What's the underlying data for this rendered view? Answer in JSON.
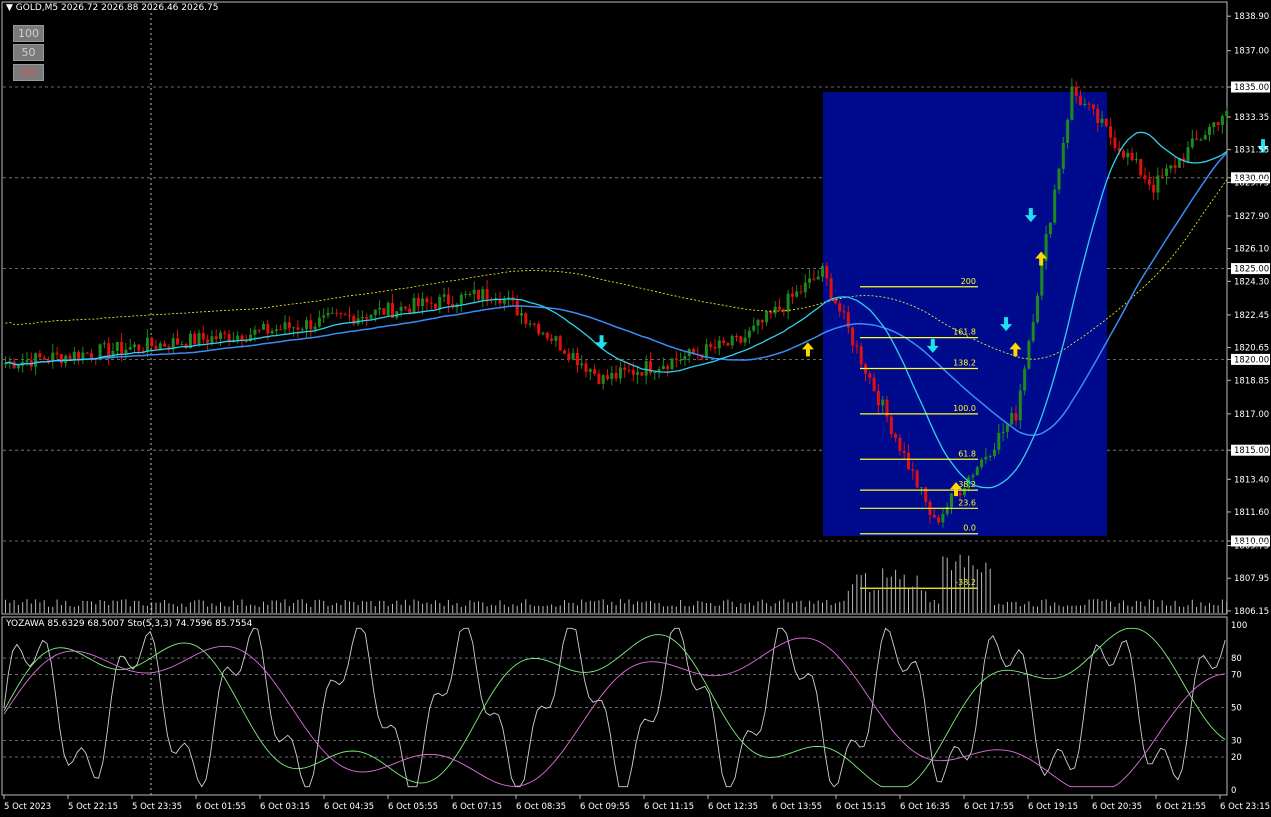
{
  "header": {
    "symbol": "GOLD,M5",
    "ohlc": "2026.72 2026.88 2026.46 2026.75",
    "menu_glyph": "▼"
  },
  "level_buttons": [
    "100",
    "50",
    "25"
  ],
  "indicator_header": "YOZAWA 85.6329 68.5007  Sto(5,3,3) 74.7596 85.7554",
  "price_axis": {
    "labels": [
      "1838.90",
      "1837.00",
      "1835.00",
      "1833.35",
      "1831.55",
      "1830.00",
      "1829.75",
      "1827.90",
      "1826.10",
      "1825.00",
      "1824.30",
      "1822.45",
      "1820.65",
      "1820.00",
      "1818.85",
      "1817.00",
      "1815.00",
      "1813.40",
      "1811.60",
      "1810.00",
      "1809.75",
      "1807.95",
      "1806.15"
    ],
    "highlighted": [
      "1835.00",
      "1830.00",
      "1825.00",
      "1820.00",
      "1815.00",
      "1810.00"
    ]
  },
  "osc_axis": {
    "labels": [
      "100",
      "80",
      "70",
      "50",
      "30",
      "20",
      "0"
    ]
  },
  "time_axis": {
    "labels": [
      "5 Oct 2023",
      "5 Oct 22:15",
      "5 Oct 23:35",
      "6 Oct 01:55",
      "6 Oct 03:15",
      "6 Oct 04:35",
      "6 Oct 05:55",
      "6 Oct 07:15",
      "6 Oct 08:35",
      "6 Oct 09:55",
      "6 Oct 11:15",
      "6 Oct 12:35",
      "6 Oct 13:55",
      "6 Oct 15:15",
      "6 Oct 16:35",
      "6 Oct 17:55",
      "6 Oct 19:15",
      "6 Oct 20:35",
      "6 Oct 21:55",
      "6 Oct 23:15"
    ]
  },
  "fib_labels": [
    "200",
    "161.8",
    "138.2",
    "100.0",
    "61.8",
    "38.2",
    "23.6",
    "0.0",
    "-38.2"
  ],
  "colors": {
    "bull": "#1e8a1e",
    "bear": "#e01010",
    "ma_fast": "#30d0f0",
    "ma_slow": "#3b8cf5",
    "ma_pink": "#e040a0",
    "fib": "#ffff20",
    "box": "#000a8c",
    "arrow_up": "#ffd700",
    "arrow_down": "#20e0f0"
  },
  "chart_data": {
    "type": "candlestick",
    "title": "",
    "symbol": "GOLD",
    "timeframe": "M5",
    "ylim": [
      1805.5,
      1839.8
    ],
    "x_range": [
      "5 Oct 2023 21:00",
      "6 Oct 23:55"
    ],
    "key_closes": [
      {
        "time": "5 Oct 21:00",
        "price": 1819.8
      },
      {
        "time": "6 Oct 01:55",
        "price": 1821.5
      },
      {
        "time": "6 Oct 06:30",
        "price": 1823.7
      },
      {
        "time": "6 Oct 08:35",
        "price": 1818.9
      },
      {
        "time": "6 Oct 11:15",
        "price": 1821.0
      },
      {
        "time": "6 Oct 12:50",
        "price": 1824.8
      },
      {
        "time": "6 Oct 15:00",
        "price": 1811.0
      },
      {
        "time": "6 Oct 16:35",
        "price": 1817.0
      },
      {
        "time": "6 Oct 17:40",
        "price": 1834.8
      },
      {
        "time": "6 Oct 19:15",
        "price": 1829.5
      },
      {
        "time": "6 Oct 20:35",
        "price": 1833.5
      },
      {
        "time": "6 Oct 23:55",
        "price": 1829.1
      }
    ],
    "fibonacci": [
      {
        "level": "200",
        "price": 1824.0
      },
      {
        "level": "161.8",
        "price": 1821.2
      },
      {
        "level": "138.2",
        "price": 1819.5
      },
      {
        "level": "100.0",
        "price": 1817.0
      },
      {
        "level": "61.8",
        "price": 1814.5
      },
      {
        "level": "38.2",
        "price": 1812.8
      },
      {
        "level": "23.6",
        "price": 1811.8
      },
      {
        "level": "0.0",
        "price": 1810.4
      },
      {
        "level": "-38.2",
        "price": 1807.4
      }
    ],
    "oscillator": {
      "ylim": [
        0,
        100
      ],
      "levels": [
        80,
        70,
        50,
        30,
        20
      ],
      "yozawa": [
        85.6329,
        68.5007
      ],
      "stochastic": [
        74.7596,
        85.7554
      ]
    }
  }
}
